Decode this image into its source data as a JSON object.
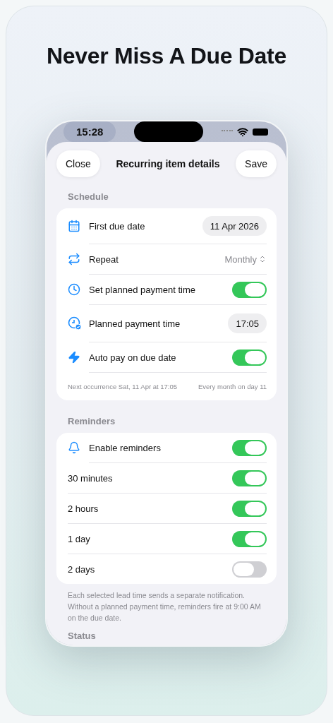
{
  "headline": "Never Miss A Due Date",
  "status_bar": {
    "time": "15:28"
  },
  "nav": {
    "close": "Close",
    "title": "Recurring item details",
    "save": "Save"
  },
  "schedule": {
    "header": "Schedule",
    "rows": [
      {
        "kind": "pill",
        "label": "First due date",
        "value": "11 Apr 2026"
      },
      {
        "kind": "menu",
        "label": "Repeat",
        "value": "Monthly"
      },
      {
        "kind": "toggle",
        "label": "Set planned payment time",
        "on": true
      },
      {
        "kind": "pill",
        "label": "Planned payment time",
        "value": "17:05"
      },
      {
        "kind": "toggle",
        "label": "Auto pay on due date",
        "on": true
      }
    ],
    "footer_left": "Next occurrence Sat, 11 Apr at 17:05",
    "footer_right": "Every month on day 11"
  },
  "reminders": {
    "header": "Reminders",
    "rows": [
      {
        "kind": "master",
        "label": "Enable reminders",
        "on": true
      },
      {
        "kind": "lead_time",
        "label": "30 minutes",
        "on": true
      },
      {
        "kind": "lead_time",
        "label": "2 hours",
        "on": true
      },
      {
        "kind": "lead_time",
        "label": "1 day",
        "on": true
      },
      {
        "kind": "lead_time",
        "label": "2 days",
        "on": false
      }
    ],
    "note": "Each selected lead time sends a separate notification. Without a planned payment time, reminders fire at 9:00 AM on the due date."
  },
  "next_section": {
    "header": "Status"
  }
}
